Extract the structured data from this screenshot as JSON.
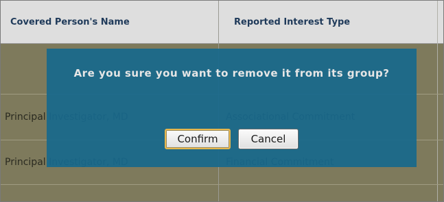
{
  "table": {
    "headers": [
      "Covered Person's Name",
      "Reported Interest Type"
    ],
    "rows": [
      {
        "name": "",
        "type": ""
      },
      {
        "name": "Principal Investigator, MD",
        "type": "Associational Commitment"
      },
      {
        "name": "Principal Investigator, MD",
        "type": "Financial Commitment"
      },
      {
        "name": "",
        "type": ""
      }
    ]
  },
  "dialog": {
    "message": "Are you sure you want to remove it from its group?",
    "confirm_label": "Confirm",
    "cancel_label": "Cancel"
  },
  "colors": {
    "dialog_bg": "#18688c",
    "table_bg": "#7e7a5c",
    "header_bg": "#dedede",
    "header_text": "#1f3a5a"
  }
}
